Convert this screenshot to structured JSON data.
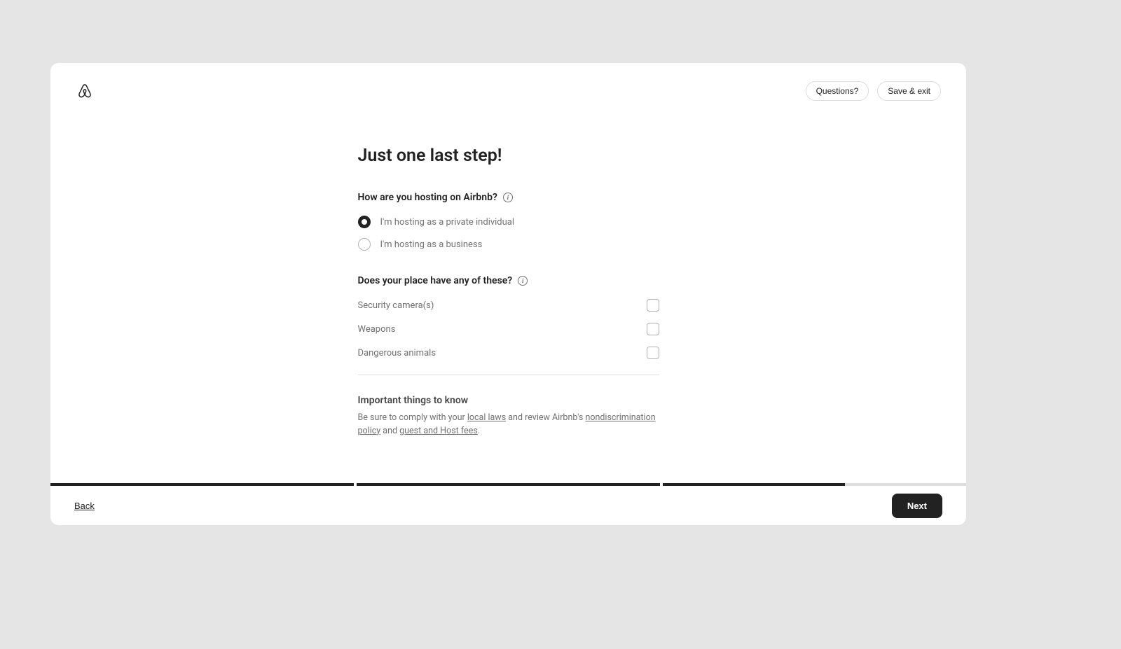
{
  "header": {
    "questions_label": "Questions?",
    "save_exit_label": "Save & exit"
  },
  "main": {
    "title": "Just one last step!",
    "hosting_question": "How are you hosting on Airbnb?",
    "radio_options": [
      {
        "label": "I'm hosting as a private individual",
        "selected": true
      },
      {
        "label": "I'm hosting as a business",
        "selected": false
      }
    ],
    "features_question": "Does your place have any of these?",
    "checkbox_items": [
      {
        "label": "Security camera(s)",
        "checked": false
      },
      {
        "label": "Weapons",
        "checked": false
      },
      {
        "label": "Dangerous animals",
        "checked": false
      }
    ],
    "important_title": "Important things to know",
    "important_prefix": "Be sure to comply with your ",
    "local_laws_link": "local laws",
    "important_mid1": " and review Airbnb's ",
    "nondiscrimination_link": "nondiscrimination policy",
    "important_mid2": " and ",
    "fees_link": "guest and Host fees",
    "important_suffix": "."
  },
  "progress": {
    "segments": [
      100,
      100,
      60
    ]
  },
  "footer": {
    "back_label": "Back",
    "next_label": "Next"
  }
}
